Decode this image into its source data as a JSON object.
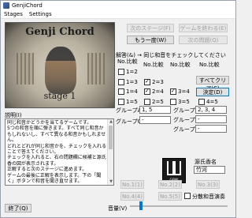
{
  "window": {
    "title": "GenjiChord"
  },
  "menu": [
    "Stages",
    "Settings"
  ],
  "cover": {
    "title": "Genji Chord",
    "stage": "stage 1"
  },
  "buttons": {
    "next_stage": "次のステージ(F)",
    "end_game": "ゲームを終わる(E)",
    "replay": "もう一度(W)",
    "next_question": "次の問題(Q)",
    "clear_all": "すべてクリア(C)",
    "decide": "決定(D)",
    "end": "終了(Q)"
  },
  "answer": {
    "header": "解答(&) → 同じ和音をチェックしてください",
    "col_header": "No.比較"
  },
  "checkboxes": [
    {
      "label": "1=2",
      "checked": false
    },
    {
      "label": "1=3",
      "checked": false
    },
    {
      "label": "2=3",
      "checked": true
    },
    {
      "label": "1=4",
      "checked": false
    },
    {
      "label": "2=4",
      "checked": true
    },
    {
      "label": "3=4",
      "checked": true
    },
    {
      "label": "1=5",
      "checked": false
    },
    {
      "label": "2=5",
      "checked": false
    },
    {
      "label": "3=5",
      "checked": false
    },
    {
      "label": "4=5",
      "checked": false
    }
  ],
  "groups": {
    "a_label": "グループA",
    "a_value": "1, 5",
    "b_label": "グループB",
    "b_value": "2, 3, 4",
    "c_label": "グループC",
    "c_value": "-",
    "d_label": "グループD",
    "d_value": "-",
    "e_label": "グループE",
    "e_value": "-"
  },
  "chapter": {
    "label": "源氏香名",
    "value": "竹河"
  },
  "description": {
    "label": "説明(I)",
    "text": "同じ和音かどうかを当てるゲームです。\n5つの和音を順に弾きます。すべて同じ和音かもしれないし、すべて異なる和音かもしれません。\nどれとどれが同じ和音かを、チェックを入れることで答えてください。\nチェックを入れると、右の問題欄に候補と源氏香の図が表示されます。\n正解すると次のステージに進めます。\nゲームの最後に正解を表示します。下の「聞く」ボタンで和音を聞き直せます。"
  },
  "logo": {
    "text": "GENJI"
  },
  "play_buttons": [
    "No.1(1)",
    "No.2(2)",
    "No.3(3)",
    "No.4(4)",
    "No.5(5)"
  ],
  "arpeggio": {
    "label": "分散和音演奏",
    "checked": false
  },
  "volume": {
    "label": "音量(V)",
    "level": 0.1
  }
}
